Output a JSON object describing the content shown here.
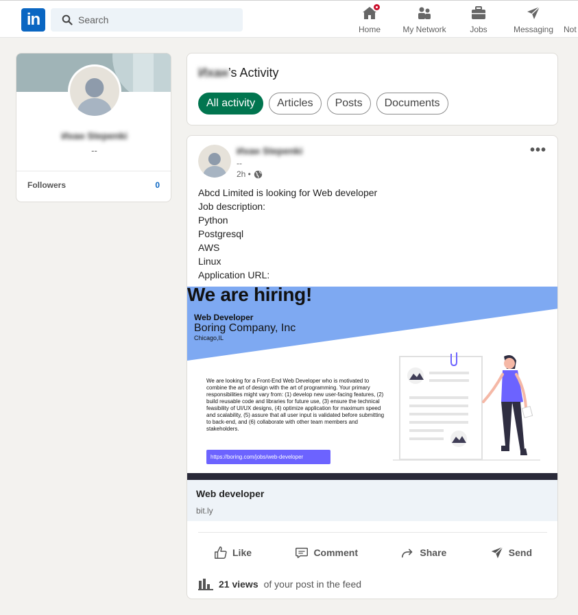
{
  "nav": {
    "search_placeholder": "Search",
    "items": [
      {
        "label": "Home"
      },
      {
        "label": "My Network"
      },
      {
        "label": "Jobs"
      },
      {
        "label": "Messaging"
      },
      {
        "label": "Not"
      }
    ]
  },
  "profile": {
    "name": "Ихан Stepenki",
    "headline": "--",
    "followers_label": "Followers",
    "followers_count": "0"
  },
  "activity": {
    "owner": "Ихан",
    "title_suffix": "’s Activity",
    "tabs": [
      "All activity",
      "Articles",
      "Posts",
      "Documents"
    ]
  },
  "post": {
    "author": "Ихан Stepenki",
    "headline": "--",
    "time": "2h •",
    "more": "•••",
    "lines": [
      "Abcd Limited is looking for Web developer",
      "Job description:",
      "Python",
      "Postgresql",
      "AWS",
      "Linux",
      "Application URL:"
    ],
    "image": {
      "heading": "We are hiring!",
      "role": "Web Developer",
      "company": "Boring Company, Inc",
      "city": "Chicago,IL",
      "description": "We are looking for a Front-End Web Developer who is motivated to combine the art of design with the art of programming. Your primary responsibilities might vary from: (1) develop new user-facing features, (2) build reusable code and libraries for future use, (3) ensure the technical feasibility of UI/UX designs, (4) optimize application for maximum speed and scalability, (5) assure that all user input is validated before submitting to back-end, and (6) collaborate with other team members and stakeholders.",
      "url": "https://boring.com/jobs/web-developer"
    },
    "link_title": "Web developer",
    "link_source": "bit.ly",
    "actions": [
      "Like",
      "Comment",
      "Share",
      "Send"
    ],
    "views_count": "21 views",
    "views_suffix": "of your post in the feed"
  },
  "colors": {
    "brand": "#0a66c2",
    "active_pill": "#01754f",
    "badge": "#cb112d",
    "banner_blue": "#7ea9f2",
    "url_button": "#6c63ff"
  }
}
